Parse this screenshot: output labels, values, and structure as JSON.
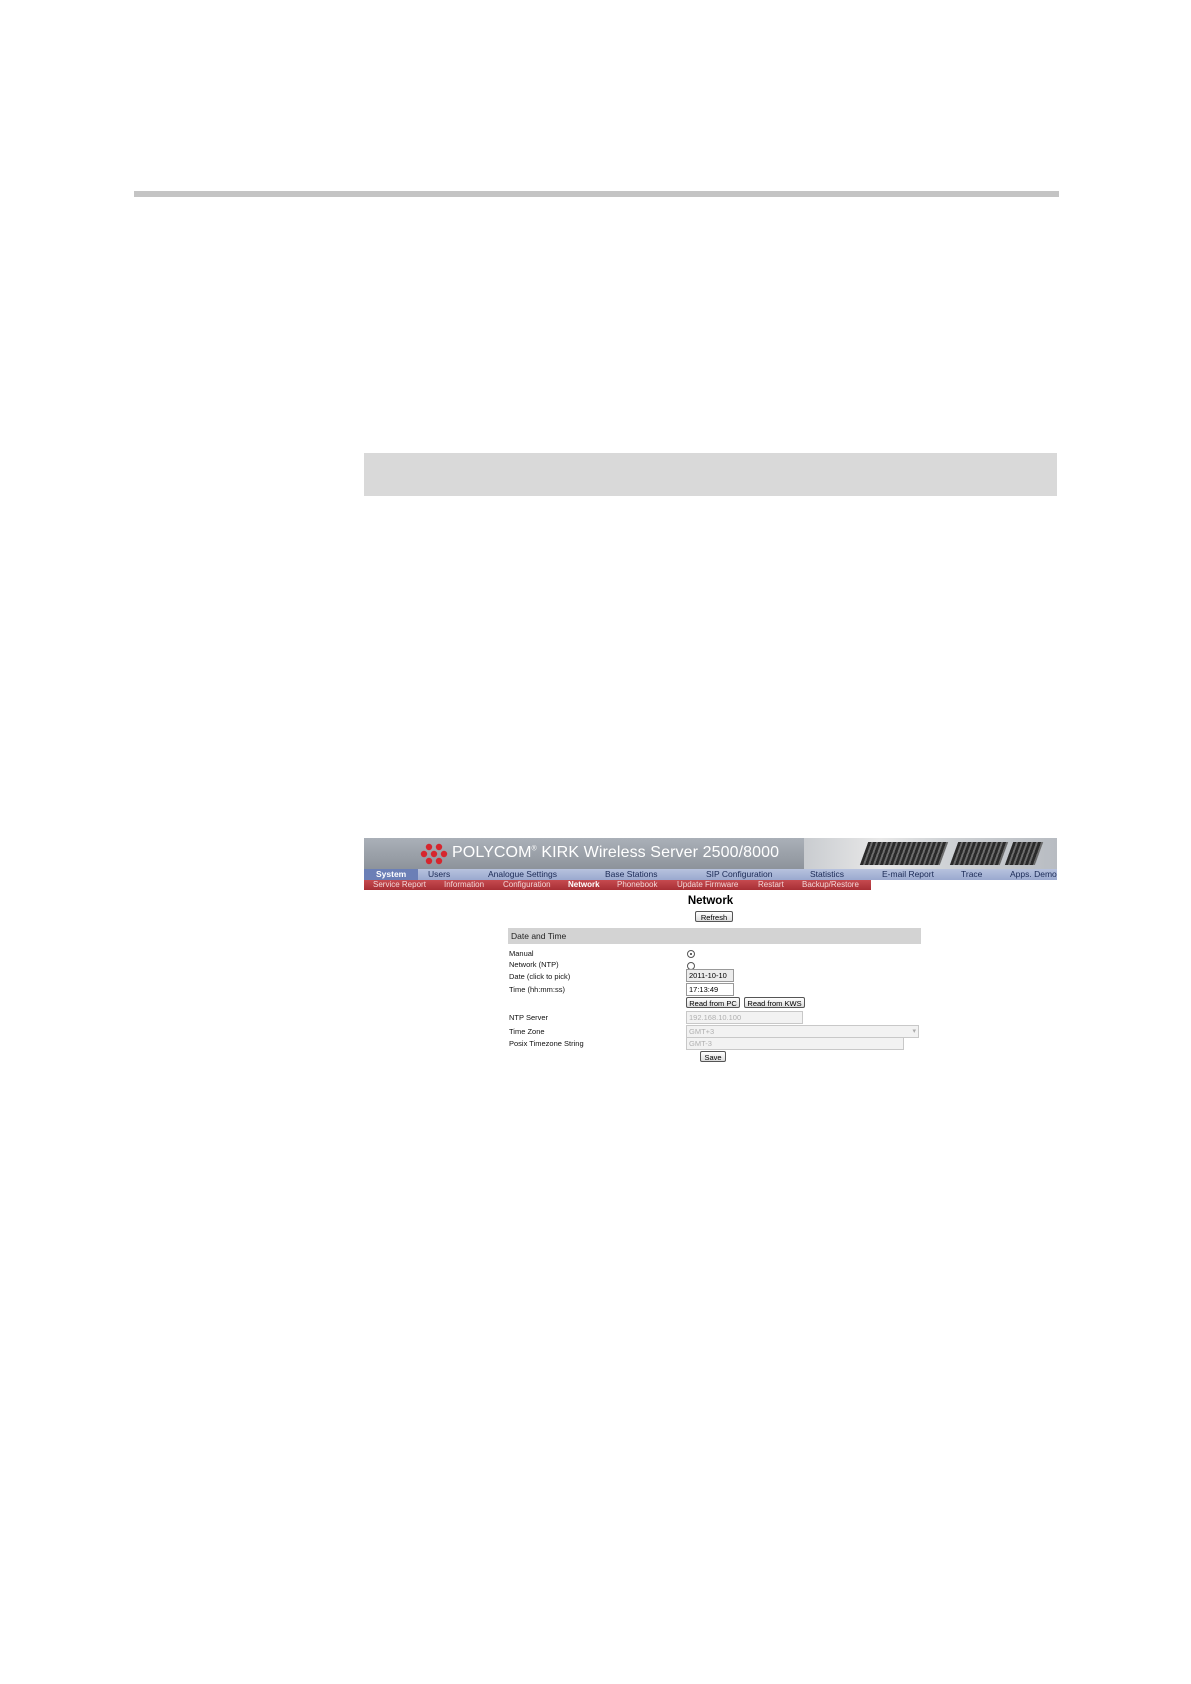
{
  "banner": {
    "brand": "POLYCOM",
    "trademark": "®",
    "product": " KIRK Wireless Server 2500/8000"
  },
  "main_nav": [
    {
      "label": "System",
      "active": true
    },
    {
      "label": "Users",
      "active": false
    },
    {
      "label": "Analogue Settings",
      "active": false
    },
    {
      "label": "Base Stations",
      "active": false
    },
    {
      "label": "SIP Configuration",
      "active": false
    },
    {
      "label": "Statistics",
      "active": false
    },
    {
      "label": "E-mail Report",
      "active": false
    },
    {
      "label": "Trace",
      "active": false
    },
    {
      "label": "Apps. Demo",
      "active": false
    }
  ],
  "sub_nav": [
    {
      "label": "Service Report",
      "active": false
    },
    {
      "label": "Information",
      "active": false
    },
    {
      "label": "Configuration",
      "active": false
    },
    {
      "label": "Network",
      "active": true
    },
    {
      "label": "Phonebook",
      "active": false
    },
    {
      "label": "Update Firmware",
      "active": false
    },
    {
      "label": "Restart",
      "active": false
    },
    {
      "label": "Backup/Restore",
      "active": false
    }
  ],
  "page": {
    "title": "Network",
    "refresh_label": "Refresh",
    "section_title": "Date and Time"
  },
  "form": {
    "manual_label": "Manual",
    "manual_selected": true,
    "ntp_label": "Network (NTP)",
    "ntp_selected": false,
    "date_label": "Date (click to pick)",
    "date_value": "2011-10-10",
    "time_label": "Time (hh:mm:ss)",
    "time_value": "17:13:49",
    "read_pc_label": "Read from PC",
    "read_kws_label": "Read from KWS",
    "ntp_server_label": "NTP Server",
    "ntp_server_value": "192.168.10.100",
    "time_zone_label": "Time Zone",
    "time_zone_value": "GMT+3",
    "posix_label": "Posix Timezone String",
    "posix_value": "GMT-3",
    "save_label": "Save"
  },
  "colors": {
    "main_nav_bg": "#9aa9cf",
    "sub_nav_bg": "#a72f35",
    "logo_red": "#d6262e"
  }
}
